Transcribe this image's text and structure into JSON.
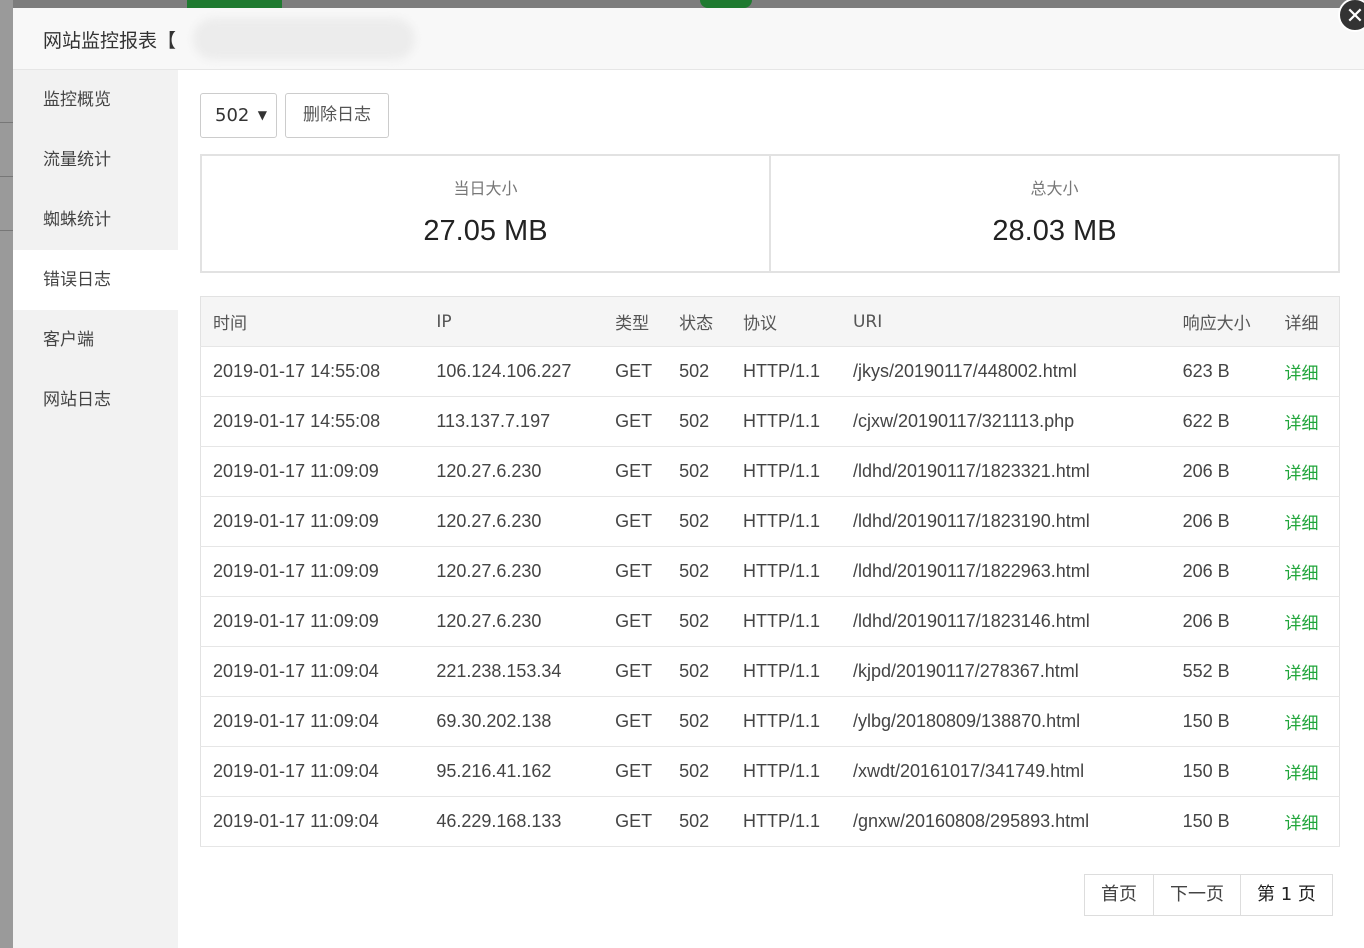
{
  "modal": {
    "title": "网站监控报表【",
    "close_symbol": "✕"
  },
  "sidebar": {
    "items": [
      {
        "label": "监控概览",
        "active": false
      },
      {
        "label": "流量统计",
        "active": false
      },
      {
        "label": "蜘蛛统计",
        "active": false
      },
      {
        "label": "错误日志",
        "active": true
      },
      {
        "label": "客户端",
        "active": false
      },
      {
        "label": "网站日志",
        "active": false
      }
    ]
  },
  "toolbar": {
    "status_select_value": "502",
    "delete_label": "删除日志"
  },
  "stats": {
    "today_label": "当日大小",
    "today_value": "27.05 MB",
    "total_label": "总大小",
    "total_value": "28.03 MB"
  },
  "table": {
    "headers": [
      "时间",
      "IP",
      "类型",
      "状态",
      "协议",
      "URI",
      "响应大小",
      "详细"
    ],
    "rows": [
      [
        "2019-01-17 14:55:08",
        "106.124.106.227",
        "GET",
        "502",
        "HTTP/1.1",
        "/jkys/20190117/448002.html",
        "623 B",
        "详细"
      ],
      [
        "2019-01-17 14:55:08",
        "113.137.7.197",
        "GET",
        "502",
        "HTTP/1.1",
        "/cjxw/20190117/321113.php",
        "622 B",
        "详细"
      ],
      [
        "2019-01-17 11:09:09",
        "120.27.6.230",
        "GET",
        "502",
        "HTTP/1.1",
        "/ldhd/20190117/1823321.html",
        "206 B",
        "详细"
      ],
      [
        "2019-01-17 11:09:09",
        "120.27.6.230",
        "GET",
        "502",
        "HTTP/1.1",
        "/ldhd/20190117/1823190.html",
        "206 B",
        "详细"
      ],
      [
        "2019-01-17 11:09:09",
        "120.27.6.230",
        "GET",
        "502",
        "HTTP/1.1",
        "/ldhd/20190117/1822963.html",
        "206 B",
        "详细"
      ],
      [
        "2019-01-17 11:09:09",
        "120.27.6.230",
        "GET",
        "502",
        "HTTP/1.1",
        "/ldhd/20190117/1823146.html",
        "206 B",
        "详细"
      ],
      [
        "2019-01-17 11:09:04",
        "221.238.153.34",
        "GET",
        "502",
        "HTTP/1.1",
        "/kjpd/20190117/278367.html",
        "552 B",
        "详细"
      ],
      [
        "2019-01-17 11:09:04",
        "69.30.202.138",
        "GET",
        "502",
        "HTTP/1.1",
        "/ylbg/20180809/138870.html",
        "150 B",
        "详细"
      ],
      [
        "2019-01-17 11:09:04",
        "95.216.41.162",
        "GET",
        "502",
        "HTTP/1.1",
        "/xwdt/20161017/341749.html",
        "150 B",
        "详细"
      ],
      [
        "2019-01-17 11:09:04",
        "46.229.168.133",
        "GET",
        "502",
        "HTTP/1.1",
        "/gnxw/20160808/295893.html",
        "150 B",
        "详细"
      ]
    ]
  },
  "pager": {
    "first_label": "首页",
    "next_label": "下一页",
    "current_label": "第 1 页"
  },
  "colors": {
    "accent": "#20a53a",
    "overlay": "#8a8a8a"
  }
}
